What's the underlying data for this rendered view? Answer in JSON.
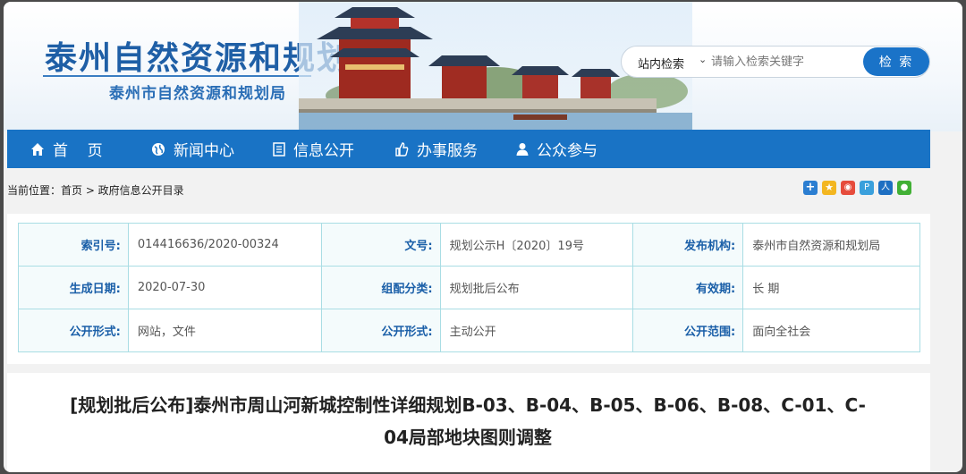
{
  "header": {
    "site_title": "泰州自然资源和规划",
    "site_subtitle": "泰州市自然资源和规划局",
    "search": {
      "scope": "站内检索",
      "placeholder": "请输入检索关键字",
      "button": "检 索"
    }
  },
  "nav": {
    "items": [
      {
        "label": "首    页",
        "icon": "home-icon"
      },
      {
        "label": "新闻中心",
        "icon": "globe-icon"
      },
      {
        "label": "信息公开",
        "icon": "document-icon"
      },
      {
        "label": "办事服务",
        "icon": "thumbs-up-icon"
      },
      {
        "label": "公众参与",
        "icon": "user-icon"
      }
    ]
  },
  "breadcrumb": "当前位置：首页 > 政府信息公开目录",
  "share_icons": [
    "more-share-icon",
    "qzone-icon",
    "weibo-icon",
    "tencent-weibo-icon",
    "renren-icon",
    "wechat-icon"
  ],
  "meta": {
    "rows": [
      [
        {
          "key": "索引号:",
          "value": "014416636/2020-00324"
        },
        {
          "key": "文号:",
          "value": "规划公示H〔2020〕19号"
        },
        {
          "key": "发布机构:",
          "value": "泰州市自然资源和规划局"
        }
      ],
      [
        {
          "key": "生成日期:",
          "value": "2020-07-30"
        },
        {
          "key": "组配分类:",
          "value": "规划批后公布"
        },
        {
          "key": "有效期:",
          "value": "长 期"
        }
      ],
      [
        {
          "key": "公开形式:",
          "value": "网站，文件"
        },
        {
          "key": "公开形式:",
          "value": "主动公开"
        },
        {
          "key": "公开范围:",
          "value": "面向全社会"
        }
      ]
    ]
  },
  "article": {
    "title_line1": "[规划批后公布]泰州市周山河新城控制性详细规划B-03、B-04、B-05、B-06、B-08、C-01、C-",
    "title_line2": "04局部地块图则调整"
  },
  "colors": {
    "nav_bg": "#1973c5",
    "search_btn": "#1a73c8",
    "title_blue": "#1f5fa6",
    "table_border": "#a9dde4"
  }
}
